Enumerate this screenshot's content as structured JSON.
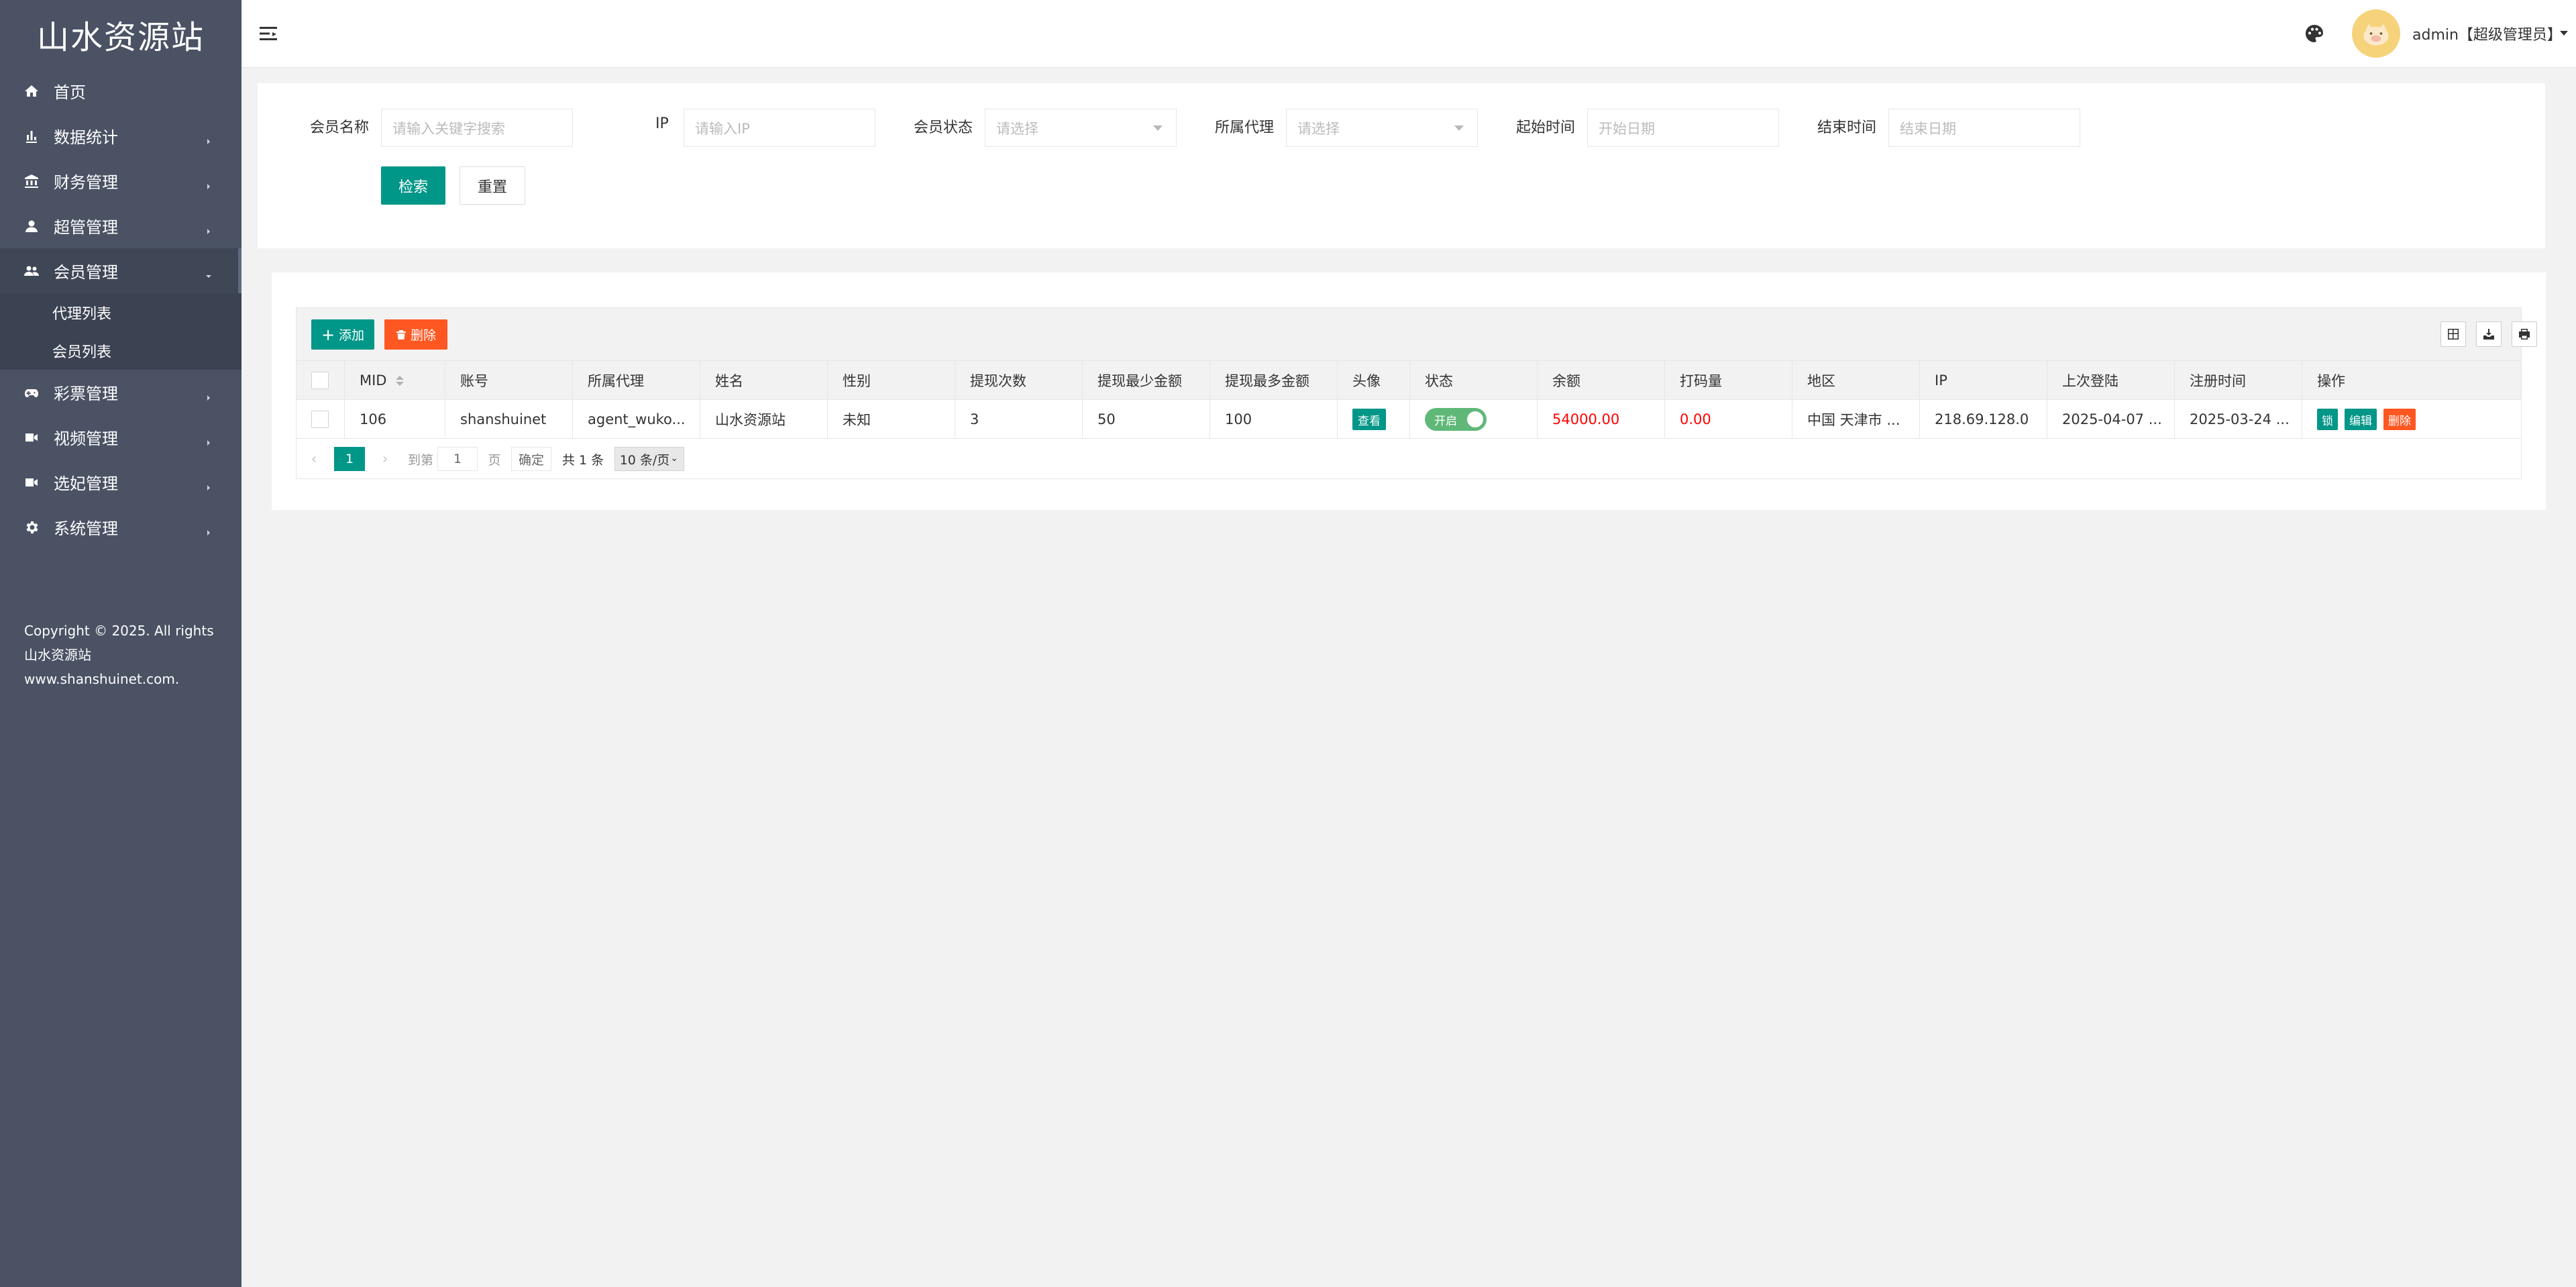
{
  "app": {
    "logo": "山水资源站"
  },
  "sidebar": {
    "items": [
      {
        "label": "首页",
        "icon": "home-icon"
      },
      {
        "label": "数据统计",
        "icon": "bar-chart-icon"
      },
      {
        "label": "财务管理",
        "icon": "bank-icon"
      },
      {
        "label": "超管管理",
        "icon": "user-icon"
      },
      {
        "label": "会员管理",
        "icon": "group-icon"
      },
      {
        "label": "彩票管理",
        "icon": "gamepad-icon"
      },
      {
        "label": "视频管理",
        "icon": "video-icon"
      },
      {
        "label": "选妃管理",
        "icon": "video-icon"
      },
      {
        "label": "系统管理",
        "icon": "gear-icon"
      }
    ],
    "submenu": [
      "代理列表",
      "会员列表"
    ],
    "copyright": "Copyright © 2025. All rights 山水资源站 www.shanshuinet.com."
  },
  "header": {
    "user": "admin【超级管理员】"
  },
  "search": {
    "name_label": "会员名称",
    "name_placeholder": "请输入关键字搜索",
    "ip_label": "IP",
    "ip_placeholder": "请输入IP",
    "status_label": "会员状态",
    "status_placeholder": "请选择",
    "agent_label": "所属代理",
    "agent_placeholder": "请选择",
    "start_label": "起始时间",
    "start_placeholder": "开始日期",
    "end_label": "结束时间",
    "end_placeholder": "结束日期",
    "search_button": "检索",
    "reset_button": "重置"
  },
  "toolbar": {
    "add": "添加",
    "delete": "删除"
  },
  "table": {
    "headers": [
      "MID",
      "账号",
      "所属代理",
      "姓名",
      "性别",
      "提现次数",
      "提现最少金额",
      "提现最多金额",
      "头像",
      "状态",
      "余额",
      "打码量",
      "地区",
      "IP",
      "上次登陆",
      "注册时间",
      "操作"
    ],
    "row": {
      "mid": "106",
      "account": "shanshuinet",
      "agent": "agent_wuko...",
      "name": "山水资源站",
      "gender": "未知",
      "withdraw_count": "3",
      "withdraw_min": "50",
      "withdraw_max": "100",
      "avatar_btn": "查看",
      "status_on": "开启",
      "balance": "54000.00",
      "betting": "0.00",
      "region": "中国 天津市 ...",
      "ip": "218.69.128.0",
      "last_login": "2025-04-07 ...",
      "register_time": "2025-03-24 ...",
      "op_1": "锁",
      "op_2": "编辑",
      "op_3": "删除"
    }
  },
  "pager": {
    "current": "1",
    "goto": "到第",
    "page_value": "1",
    "page_unit": "页",
    "confirm": "确定",
    "total": "共 1 条",
    "size": "10 条/页"
  },
  "colors": {
    "primary": "#009688",
    "danger": "#ff5722",
    "sidebar": "#4a5264",
    "switch_on": "#5fb878"
  }
}
